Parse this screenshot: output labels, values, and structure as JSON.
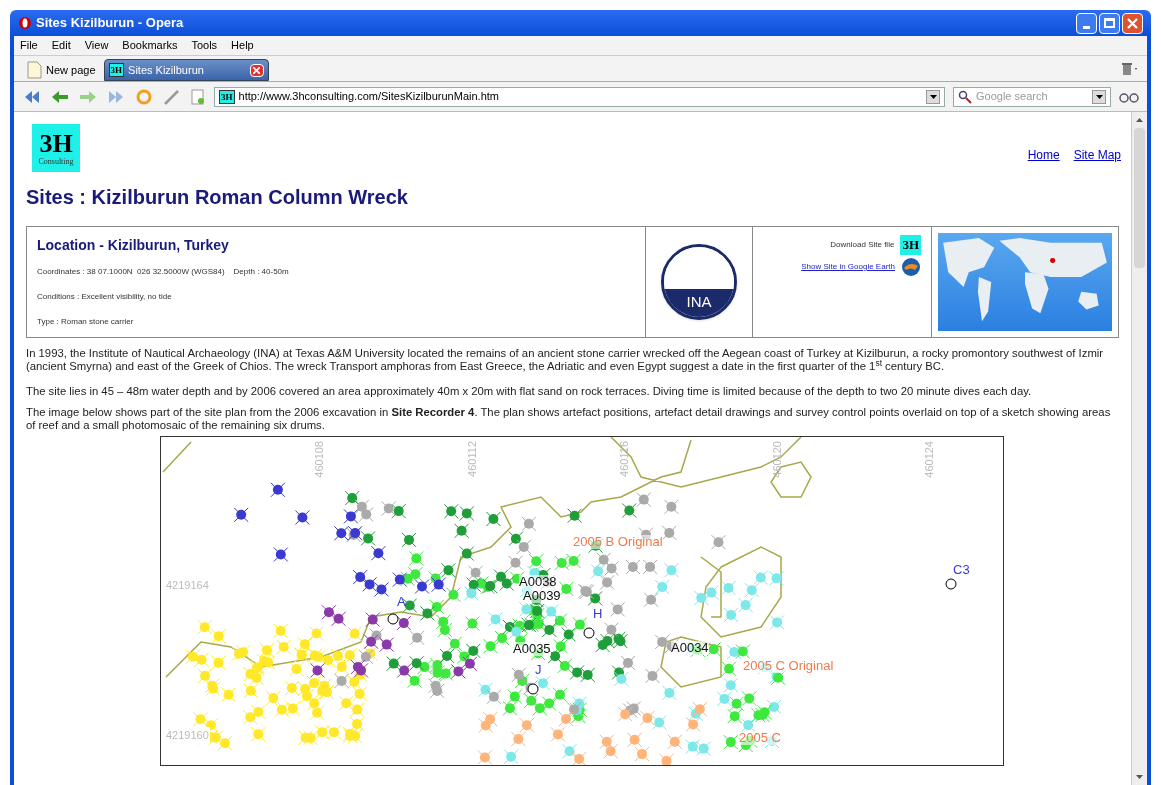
{
  "window": {
    "title": "Sites Kizilburun - Opera"
  },
  "menu": [
    "File",
    "Edit",
    "View",
    "Bookmarks",
    "Tools",
    "Help"
  ],
  "tabs": [
    {
      "label": "New page",
      "selected": false
    },
    {
      "label": "Sites Kizilburun",
      "selected": true,
      "icon_text": "3H"
    }
  ],
  "address_bar": {
    "favicon_text": "3H",
    "url": "http://www.3hconsulting.com/SitesKizilburunMain.htm"
  },
  "search": {
    "placeholder": "Google search"
  },
  "page": {
    "logo": {
      "text": "3H",
      "subtext": "Consulting"
    },
    "nav_links": [
      "Home",
      "Site Map"
    ],
    "title": "Sites : Kizilburun Roman Column Wreck",
    "location": {
      "heading": "Location - Kizilburun, Turkey",
      "lines": [
        "Coordinates : 38 07.1000N  026 32.5000W (WGS84)    Depth : 40-50m",
        "Conditions : Excellent visibility, no tide",
        "Type : Roman stone carrier"
      ],
      "ina_logo": "INA",
      "download_label": "Download Site file",
      "download_icon": "3H",
      "earth_link": "Show Site in Google Earth"
    },
    "paragraphs": [
      "In 1993, the Institute of Nautical Archaeology (INA) at Texas A&M University located the remains of an ancient stone carrier wrecked off the Aegean coast of Turkey at Kizilburun, a rocky promontory southwest of Izmir (ancient Smyrna) and east of the Greek of Chios.  The wreck Transport amphoras from East Greece, the Adriatic and even Egypt suggest a date in the first quarter of the 1$^{st}$ century BC.",
      "The site lies in 45 – 48m water depth and by 2006 covered an area approximately 40m x 20m with flat sand on rock terraces.  Diving time is limited because of the depth to two 20 minute dives each day.",
      "The image below shows part of the site plan from the 2006 excavation in **Site Recorder 4**.  The plan shows artefact positions, artefact detail drawings and survey control points overlaid on top of a sketch showing areas of reef and a small photomosaic of the remaining six drums."
    ],
    "site_plan": {
      "grid_labels": [
        {
          "kind": "x",
          "text": "460108"
        },
        {
          "kind": "x",
          "text": "460112"
        },
        {
          "kind": "x",
          "text": "460116"
        },
        {
          "kind": "x",
          "text": "460120"
        },
        {
          "kind": "x",
          "text": "460124"
        },
        {
          "kind": "y",
          "text": "4219164"
        },
        {
          "kind": "y",
          "text": "4219160"
        }
      ],
      "labels": [
        {
          "kind": "artefact",
          "text": "A0038"
        },
        {
          "kind": "artefact",
          "text": "A0039"
        },
        {
          "kind": "artefact",
          "text": "A0035"
        },
        {
          "kind": "artefact",
          "text": "A0034"
        },
        {
          "kind": "control",
          "text": "A"
        },
        {
          "kind": "control",
          "text": "H"
        },
        {
          "kind": "control",
          "text": "J"
        },
        {
          "kind": "control",
          "text": "C3"
        },
        {
          "kind": "area",
          "text": "2005 B Original"
        },
        {
          "kind": "area",
          "text": "2005 C Original"
        },
        {
          "kind": "area",
          "text": "2005 C"
        }
      ]
    }
  }
}
